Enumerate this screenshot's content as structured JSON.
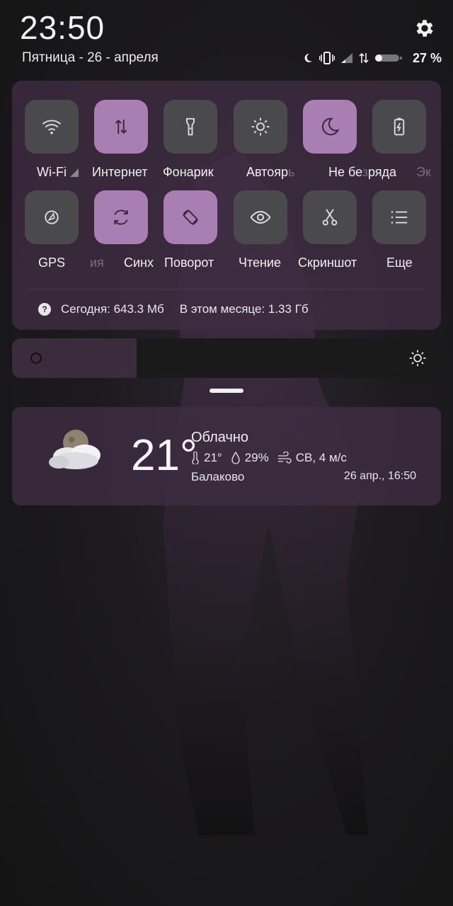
{
  "header": {
    "time": "23:50",
    "date": "Пятница - 26 - апреля",
    "battery_percent": "27 %",
    "battery_level": 0.27
  },
  "status_icons": [
    "moon-icon",
    "vibrate-icon",
    "signal-icon",
    "data-arrows-icon",
    "battery-icon"
  ],
  "quick_settings": {
    "row1": [
      {
        "label": "Wi-Fi",
        "icon": "wifi-icon",
        "on": false
      },
      {
        "label": "Интернет",
        "icon": "mobile-data-icon",
        "on": true
      },
      {
        "label": "Фонарик",
        "icon": "flashlight-icon",
        "on": false
      },
      {
        "label": "Автояр",
        "icon": "brightness-auto-icon",
        "on": false
      },
      {
        "label": "Не бе",
        "icon": "do-not-disturb-icon",
        "on": true
      },
      {
        "label": "Эк",
        "icon": "battery-saver-icon",
        "on": false
      }
    ],
    "row1_label_tails": {
      "autobright": "ь",
      "dnd": "ряда"
    },
    "row2": [
      {
        "label": "GPS",
        "icon": "gps-icon",
        "on": false
      },
      {
        "label": "Синх",
        "icon": "sync-icon",
        "on": true
      },
      {
        "label": "Поворот",
        "icon": "rotate-icon",
        "on": true
      },
      {
        "label": "Чтение",
        "icon": "eye-icon",
        "on": false
      },
      {
        "label": "Скриншот",
        "icon": "scissors-icon",
        "on": false
      },
      {
        "label": "Еще",
        "icon": "menu-list-icon",
        "on": false
      }
    ],
    "row2_label_fragment": "ия",
    "data_usage": {
      "today": "Сегодня: 643.3 Мб",
      "month": "В этом месяце: 1.33 Гб"
    }
  },
  "brightness": {
    "level": 0.29
  },
  "weather": {
    "temperature": "21°",
    "condition": "Облачно",
    "feels_temp": "21°",
    "humidity": "29%",
    "wind": "СВ, 4 м/с",
    "city": "Балаково",
    "updated": "26 апр., 16:50",
    "icon": "cloudy-night-icon"
  },
  "colors": {
    "accent": "#a97eb3",
    "tile_off": "#4a4a4c",
    "panel": "#3f2d42"
  }
}
